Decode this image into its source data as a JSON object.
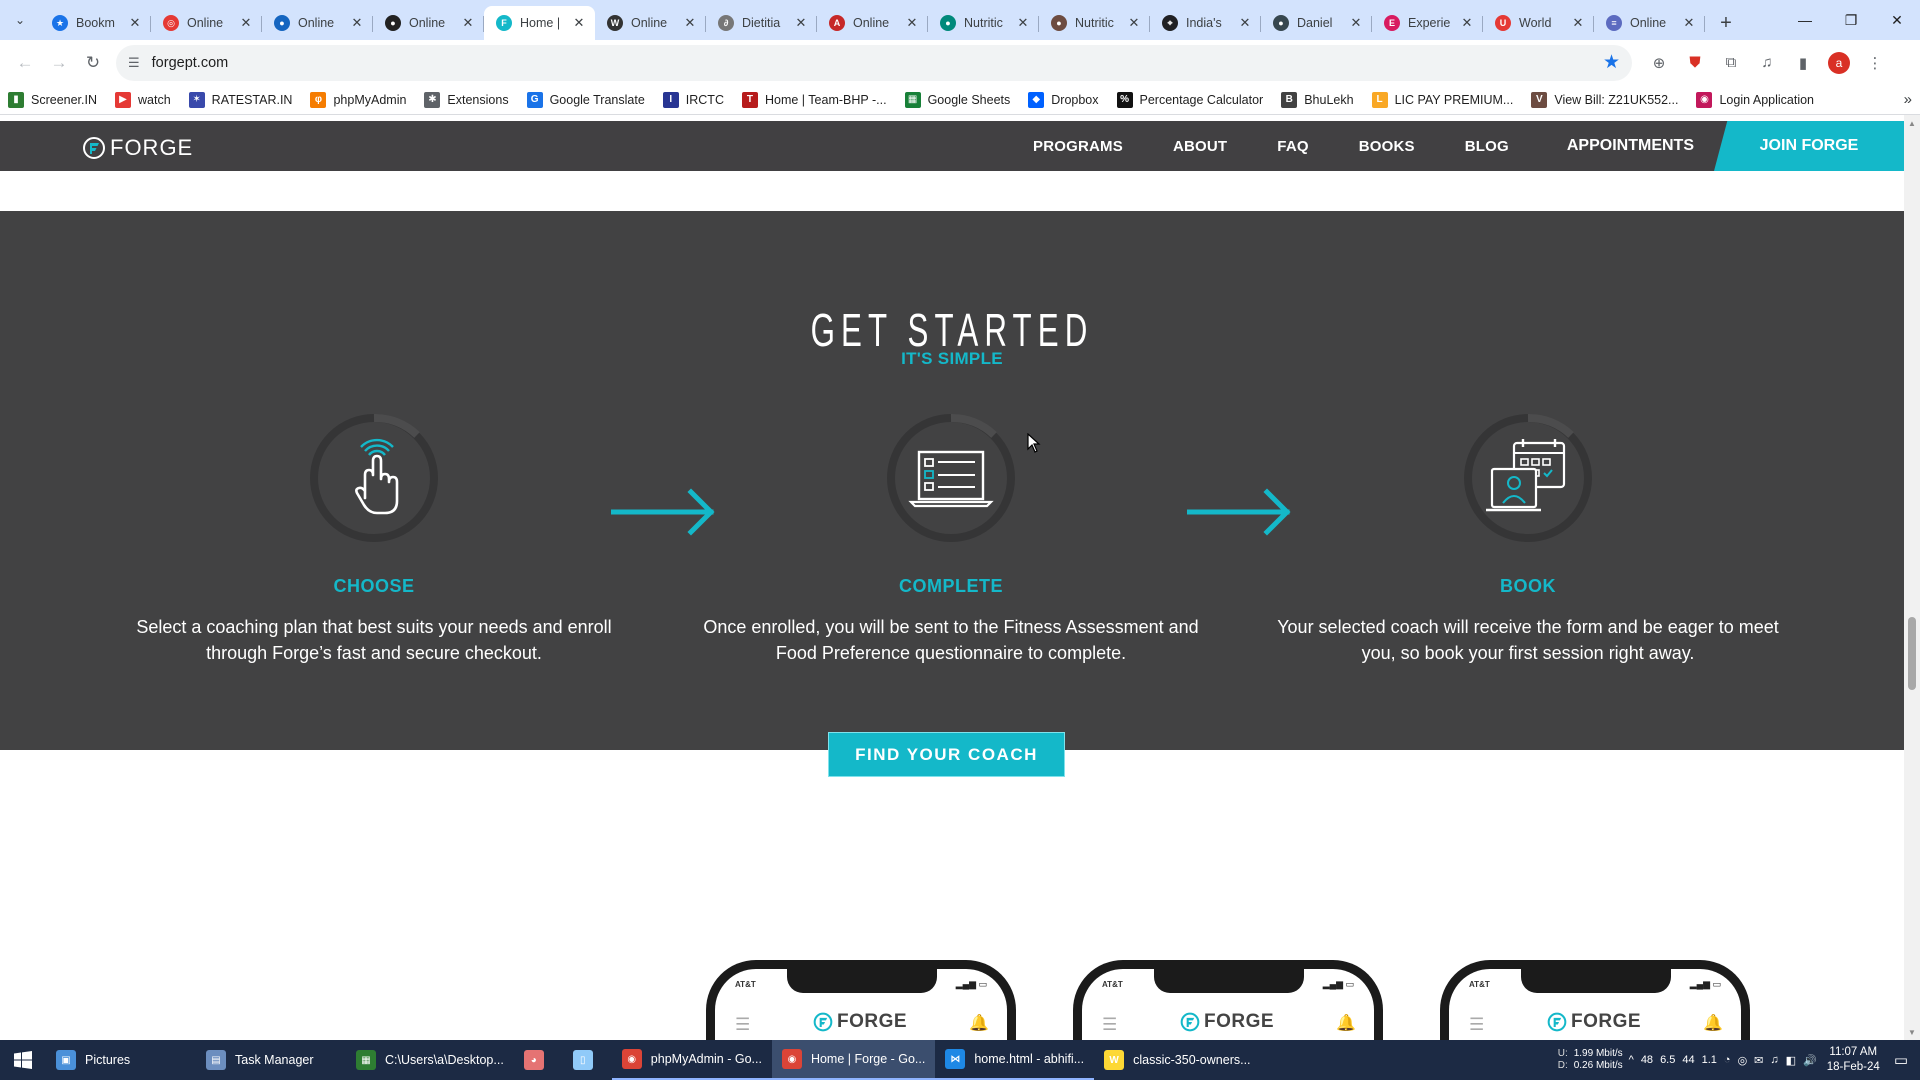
{
  "browser": {
    "tabs": [
      {
        "title": "Bookm",
        "color": "#1a73e8",
        "glyph": "★"
      },
      {
        "title": "Online",
        "color": "#e53935",
        "glyph": "◎"
      },
      {
        "title": "Online",
        "color": "#1565c0",
        "glyph": "●"
      },
      {
        "title": "Online",
        "color": "#222222",
        "glyph": "●"
      },
      {
        "title": "Home |",
        "color": "#14b8c9",
        "glyph": "F",
        "active": true
      },
      {
        "title": "Online",
        "color": "#333333",
        "glyph": "W"
      },
      {
        "title": "Dietitia",
        "color": "#777777",
        "glyph": "∂"
      },
      {
        "title": "Online",
        "color": "#c62828",
        "glyph": "A"
      },
      {
        "title": "Nutritic",
        "color": "#00897b",
        "glyph": "●"
      },
      {
        "title": "Nutritic",
        "color": "#6d4c41",
        "glyph": "●"
      },
      {
        "title": "India's",
        "color": "#202124",
        "glyph": "⌖"
      },
      {
        "title": "Daniel",
        "color": "#37474f",
        "glyph": "●"
      },
      {
        "title": "Experie",
        "color": "#d81b60",
        "glyph": "E"
      },
      {
        "title": "World",
        "color": "#e53935",
        "glyph": "U"
      },
      {
        "title": "Online",
        "color": "#5c6bc0",
        "glyph": "≡"
      }
    ],
    "url": "forgept.com",
    "profile_initial": "a",
    "bookmarks": [
      {
        "label": "Screener.IN",
        "color": "#2e7d32",
        "glyph": "▮"
      },
      {
        "label": "watch",
        "color": "#e53935",
        "glyph": "▶"
      },
      {
        "label": "RATESTAR.IN",
        "color": "#3949ab",
        "glyph": "✶"
      },
      {
        "label": "phpMyAdmin",
        "color": "#f57c00",
        "glyph": "φ"
      },
      {
        "label": "Extensions",
        "color": "#5f6368",
        "glyph": "✱"
      },
      {
        "label": "Google Translate",
        "color": "#1a73e8",
        "glyph": "G"
      },
      {
        "label": "IRCTC",
        "color": "#283593",
        "glyph": "I"
      },
      {
        "label": "Home | Team-BHP -...",
        "color": "#b71c1c",
        "glyph": "T"
      },
      {
        "label": "Google Sheets",
        "color": "#188038",
        "glyph": "▦"
      },
      {
        "label": "Dropbox",
        "color": "#0061ff",
        "glyph": "◆"
      },
      {
        "label": "Percentage Calculator",
        "color": "#111111",
        "glyph": "%"
      },
      {
        "label": "BhuLekh",
        "color": "#424242",
        "glyph": "B"
      },
      {
        "label": "LIC PAY PREMIUM...",
        "color": "#f9a825",
        "glyph": "L"
      },
      {
        "label": "View Bill: Z21UK552...",
        "color": "#6d4c41",
        "glyph": "V"
      },
      {
        "label": "Login Application",
        "color": "#c2185b",
        "glyph": "◉"
      }
    ]
  },
  "site": {
    "logo_text": "FORGE",
    "nav": [
      "PROGRAMS",
      "ABOUT",
      "FAQ",
      "BOOKS",
      "BLOG"
    ],
    "appointments": "APPOINTMENTS",
    "join": "JOIN FORGE",
    "accent": "#14b8c9",
    "section": {
      "title": "GET STARTED",
      "subtitle": "IT'S SIMPLE",
      "steps": [
        {
          "heading": "CHOOSE",
          "text": "Select a coaching plan that best suits your needs and enroll through Forge’s fast and secure checkout.",
          "icon": "hand-tap-icon"
        },
        {
          "heading": "COMPLETE",
          "text": "Once enrolled, you will be sent to the Fitness Assessment and Food Preference questionnaire to complete.",
          "icon": "checklist-laptop-icon"
        },
        {
          "heading": "BOOK",
          "text": "Your selected coach will receive the form and be eager to meet you, so book your first session right away.",
          "icon": "calendar-coach-icon"
        }
      ],
      "cta": "FIND YOUR COACH"
    },
    "phones": [
      {
        "carrier": "AT&T",
        "logo": "FORGE"
      },
      {
        "carrier": "AT&T",
        "logo": "FORGE"
      },
      {
        "carrier": "AT&T",
        "logo": "FORGE"
      }
    ]
  },
  "taskbar": {
    "items": [
      {
        "label": "Pictures",
        "color": "#4a90d9",
        "glyph": "▣"
      },
      {
        "label": "Task Manager",
        "color": "#6c8ebf",
        "glyph": "▤"
      },
      {
        "label": "C:\\Users\\a\\Desktop...",
        "color": "#2e7d32",
        "glyph": "▦"
      },
      {
        "label": "",
        "color": "#e57373",
        "glyph": "◕"
      },
      {
        "label": "",
        "color": "#90caf9",
        "glyph": "▯"
      },
      {
        "label": "phpMyAdmin - Go...",
        "color": "#db4437",
        "glyph": "◉",
        "open": true
      },
      {
        "label": "Home | Forge - Go...",
        "color": "#db4437",
        "glyph": "◉",
        "active": true
      },
      {
        "label": "home.html - abhifi...",
        "color": "#1e88e5",
        "glyph": "⋈",
        "open": true
      },
      {
        "label": "classic-350-owners...",
        "color": "#fdd835",
        "glyph": "W"
      }
    ],
    "net_up_label": "U:",
    "net_down_label": "D:",
    "net_up": "1.99 Mbit/s",
    "net_down": "0.26 Mbit/s",
    "tray": [
      "^",
      "48",
      "6.5",
      "44",
      "1.1"
    ],
    "time": "11:07 AM",
    "date": "18-Feb-24"
  }
}
